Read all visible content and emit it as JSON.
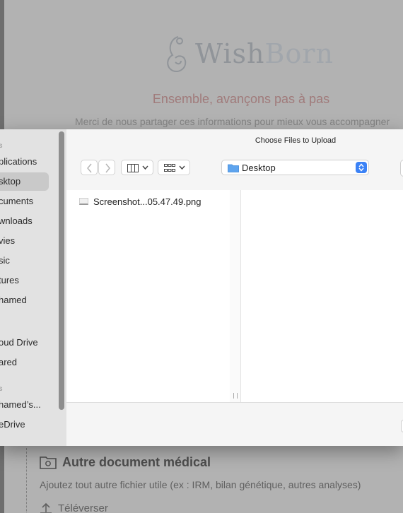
{
  "background_page": {
    "logo_text_part1": "Wish",
    "logo_text_part2": "Born",
    "tagline": "Ensemble, avançons pas à pas",
    "subline": "Merci de nous partager ces informations pour mieux vous accompagner",
    "other_doc_title": "Autre document médical",
    "other_doc_description": "Ajoutez tout autre fichier utile (ex : IRM, bilan génétique, autres analyses)",
    "upload_label": "Téléverser"
  },
  "dialog": {
    "title": "Choose Files to Upload",
    "location": "Desktop",
    "files": [
      {
        "name": "Screenshot...05.47.49.png",
        "icon": "png-file-icon"
      }
    ]
  },
  "sidebar": {
    "sections": [
      {
        "label": "s"
      },
      {
        "label": "s"
      }
    ],
    "items": [
      {
        "label": "plications",
        "icon": "applications-icon"
      },
      {
        "label": "sktop",
        "icon": "desktop-icon",
        "active": true
      },
      {
        "label": "cuments",
        "icon": "documents-icon"
      },
      {
        "label": "wnloads",
        "icon": "downloads-icon"
      },
      {
        "label": "vies",
        "icon": "movies-icon"
      },
      {
        "label": "sic",
        "icon": "music-icon"
      },
      {
        "label": "tures",
        "icon": "pictures-icon"
      },
      {
        "label": "hamed",
        "icon": "home-icon"
      },
      {
        "label": "oud Drive",
        "icon": "icloud-icon"
      },
      {
        "label": "ared",
        "icon": "shared-icon"
      },
      {
        "label": "hamed’s...",
        "icon": "computer-icon"
      },
      {
        "label": "eDrive",
        "icon": "onedrive-icon"
      }
    ]
  },
  "colors": {
    "accent": "#3b82f6",
    "tagline": "#e6b0b0",
    "sidebar_bg": "#e2e2e2"
  }
}
